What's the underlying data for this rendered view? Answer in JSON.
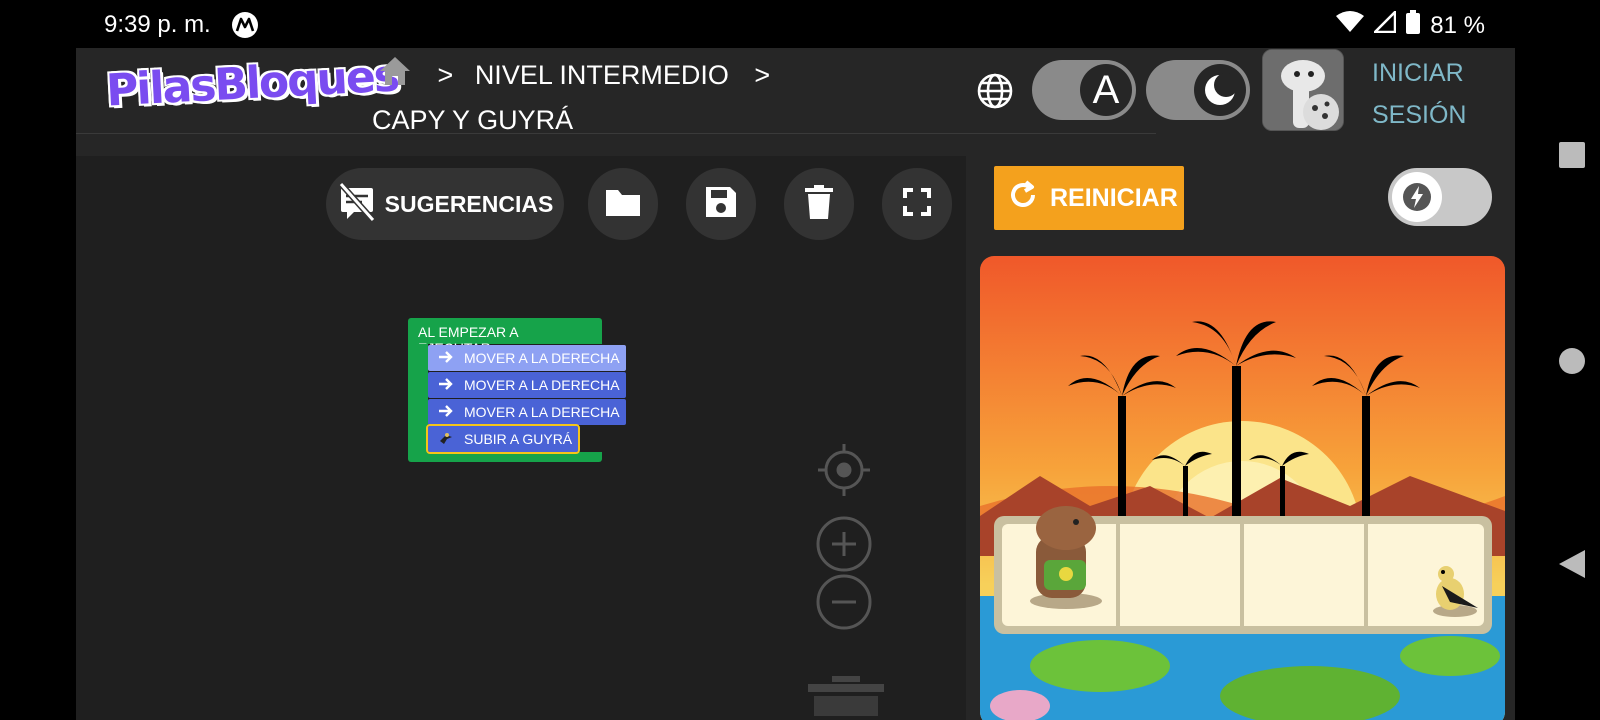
{
  "status": {
    "time": "9:39 p. m.",
    "battery": "81 %"
  },
  "header": {
    "logo": "PilasBloques",
    "breadcrumb_sep1": ">",
    "breadcrumb_level": "NIVEL INTERMEDIO",
    "breadcrumb_sep2": ">",
    "breadcrumb_challenge": "CAPY Y GUYRÁ",
    "contrast_label": "A",
    "login_line1": "INICIAR",
    "login_line2": "SESIÓN"
  },
  "toolbar": {
    "suggestions_label": "SUGERENCIAS"
  },
  "blocks": {
    "hat_label": "AL EMPEZAR A EJECUTAR",
    "items": [
      {
        "label": "MOVER A LA DERECHA"
      },
      {
        "label": "MOVER A LA DERECHA"
      },
      {
        "label": "MOVER A LA DERECHA"
      },
      {
        "label": "SUBIR A GUYRÁ"
      }
    ]
  },
  "scene_panel": {
    "reset_label": "REINICIAR"
  },
  "colors": {
    "accent_orange": "#f4a11d",
    "block_blue": "#4a63d6",
    "hat_green": "#16a34a",
    "login_teal": "#7fb8c8"
  }
}
